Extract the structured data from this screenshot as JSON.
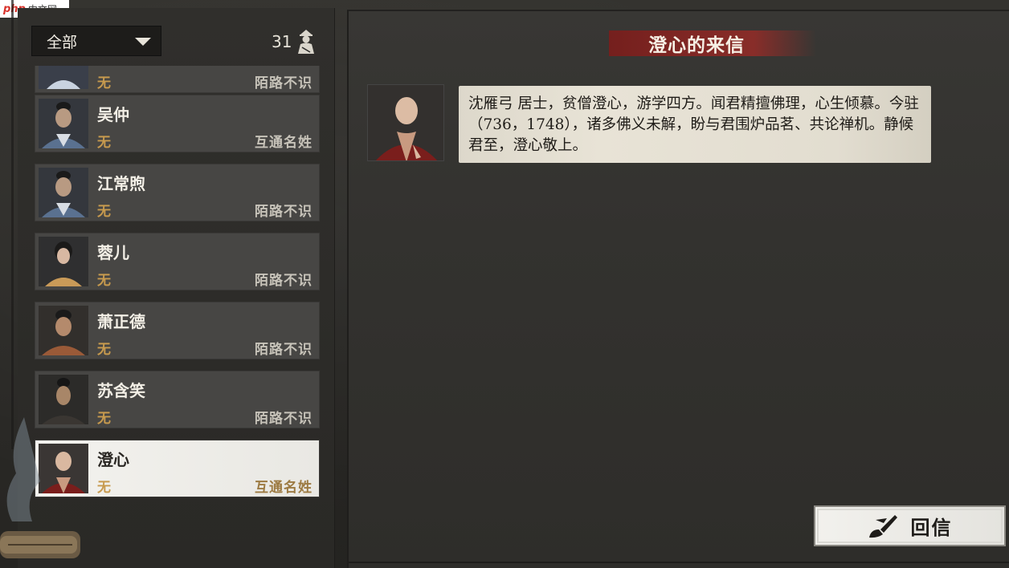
{
  "watermark": {
    "brand": "php",
    "suffix": "中文网"
  },
  "filter": {
    "selected": "全部"
  },
  "friend_count": "31",
  "contacts": [
    {
      "name": "",
      "sect": "无",
      "relation": "陌路不识",
      "selected": false
    },
    {
      "name": "吴仲",
      "sect": "无",
      "relation": "互通名姓",
      "selected": false
    },
    {
      "name": "江常煦",
      "sect": "无",
      "relation": "陌路不识",
      "selected": false
    },
    {
      "name": "蓉儿",
      "sect": "无",
      "relation": "陌路不识",
      "selected": false
    },
    {
      "name": "萧正德",
      "sect": "无",
      "relation": "陌路不识",
      "selected": false
    },
    {
      "name": "苏含笑",
      "sect": "无",
      "relation": "陌路不识",
      "selected": false
    },
    {
      "name": "澄心",
      "sect": "无",
      "relation": "互通名姓",
      "selected": true
    }
  ],
  "letter": {
    "title": "澄心的来信",
    "body": "沈雁弓 居士，贫僧澄心，游学四方。闻君精擅佛理，心生倾慕。今驻（736，1748），诸多佛义未解，盼与君围炉品茗、共论禅机。静候君至，澄心敬上。"
  },
  "reply_button": {
    "label": "回信"
  },
  "colors": {
    "banner_red": "#8f2c28",
    "sect_gold": "#c79a4e"
  }
}
